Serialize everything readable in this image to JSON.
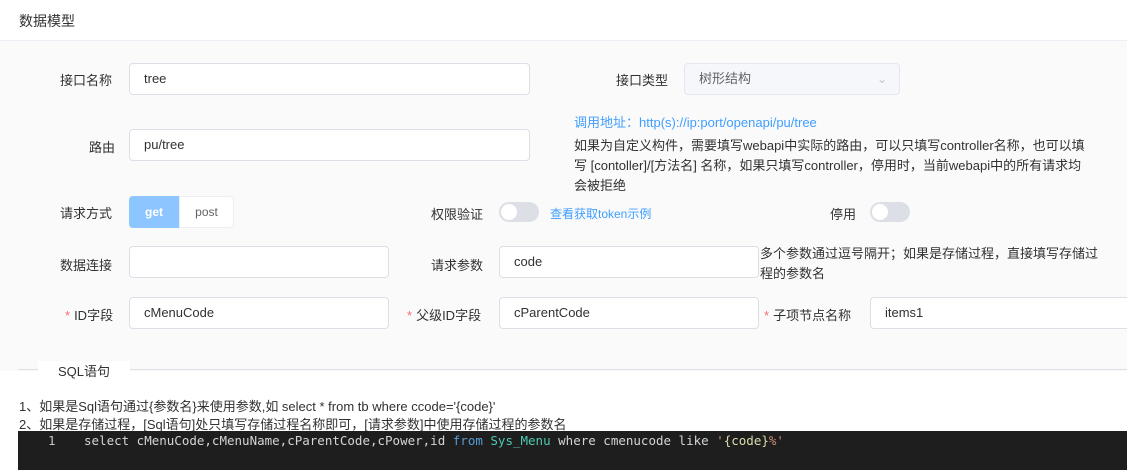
{
  "header": {
    "title": "数据模型"
  },
  "form": {
    "name": {
      "label": "接口名称",
      "value": "tree"
    },
    "type": {
      "label": "接口类型",
      "value": "树形结构"
    },
    "call_address": {
      "label": "调用地址：",
      "value": "http(s)://ip:port/openapi/pu/tree"
    },
    "route": {
      "label": "路由",
      "value": "pu/tree",
      "help": [
        "如果为自定义构件，需要填写webapi中实际的路由，可以只填写controller名称，也可以填",
        "写 [contoller]/[方法名] 名称，如果只填写controller，停用时，当前webapi中的所有请求均",
        "会被拒绝"
      ]
    },
    "method": {
      "label": "请求方式",
      "options": [
        "get",
        "post"
      ],
      "selected": "get"
    },
    "auth": {
      "label": "权限验证",
      "enabled": false,
      "link": "查看获取token示例"
    },
    "disabled": {
      "label": "停用",
      "enabled": false
    },
    "connection": {
      "label": "数据连接",
      "value": ""
    },
    "params": {
      "label": "请求参数",
      "value": "code",
      "help": [
        "多个参数通过逗号隔开；如果是存储过程，直接填写存储过",
        "程的参数名"
      ]
    },
    "id_field": {
      "label": "ID字段",
      "value": "cMenuCode"
    },
    "parent_id_field": {
      "label": "父级ID字段",
      "value": "cParentCode"
    },
    "child_node_name": {
      "label": "子项节点名称",
      "value": "items1"
    },
    "required_mark": "*"
  },
  "sql": {
    "section_title": "SQL语句",
    "notes": [
      "1、如果是Sql语句通过{参数名}来使用参数,如 select * from tb where ccode='{code}'",
      "2、如果是存储过程，[Sql语句]处只填写存储过程名称即可，[请求参数]中使用存储过程的参数名"
    ],
    "line_number": "1",
    "code": {
      "part1": "select cMenuCode,cMenuName,cParentCode,cPower,id ",
      "kw_from": "from",
      "space1": " ",
      "table": "Sys_Menu",
      "part2": " where cmenucode like ",
      "quote_open": "'",
      "template": "{code}",
      "quote_close": "%'"
    }
  },
  "icons": {
    "select_arrow": "chevron-down-icon"
  }
}
